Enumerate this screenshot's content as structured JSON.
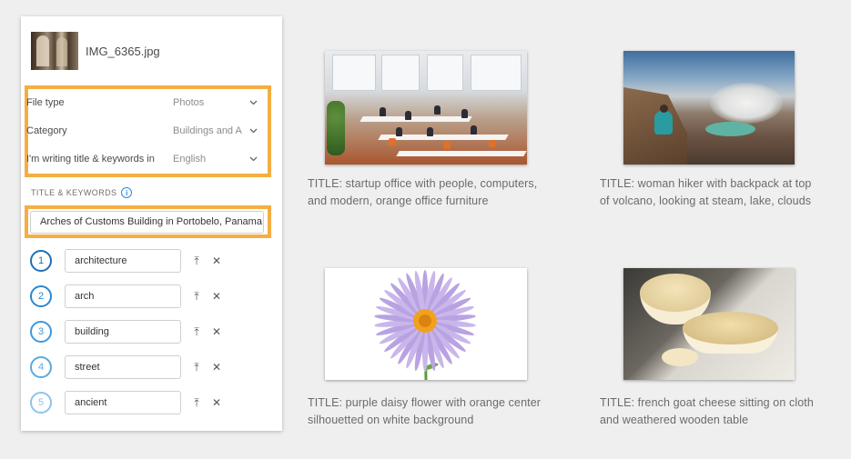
{
  "panel": {
    "file_name": "IMG_6365.jpg",
    "settings": [
      {
        "label": "File type",
        "value": "Photos"
      },
      {
        "label": "Category",
        "value": "Buildings and A"
      },
      {
        "label": "I'm writing title & keywords in",
        "value": "English"
      }
    ],
    "title_keywords_label": "TITLE & KEYWORDS",
    "title_value": "Arches of Customs Building in Portobelo, Panama",
    "keywords": [
      {
        "num": "1",
        "text": "architecture"
      },
      {
        "num": "2",
        "text": "arch"
      },
      {
        "num": "3",
        "text": "building"
      },
      {
        "num": "4",
        "text": "street"
      },
      {
        "num": "5",
        "text": "ancient"
      }
    ],
    "accent_color": "#f4ae43",
    "keyword_num_color": "#1d6fb6"
  },
  "gallery": [
    {
      "caption_line1": "TITLE: startup office with people, computers,",
      "caption_line2": "and modern, orange office furniture"
    },
    {
      "caption_line1": "TITLE: woman hiker with backpack at top",
      "caption_line2": "of volcano, looking at steam, lake, clouds"
    },
    {
      "caption_line1": "TITLE: purple daisy flower with orange center",
      "caption_line2": "silhouetted on white background"
    },
    {
      "caption_line1": "TITLE: french goat cheese  sitting on cloth",
      "caption_line2": "and weathered wooden table"
    }
  ]
}
